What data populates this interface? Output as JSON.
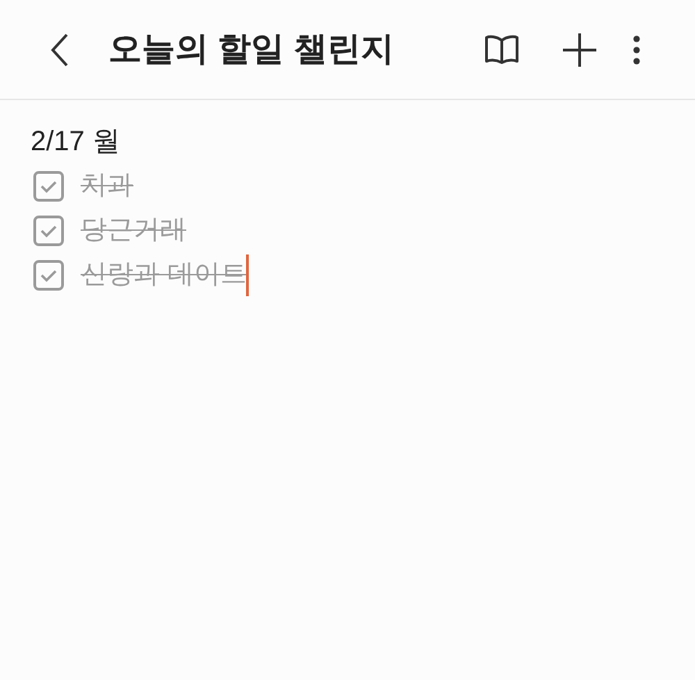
{
  "header": {
    "title": "오늘의 할일 챌린지"
  },
  "date": "2/17 월",
  "items": [
    {
      "text": "치과",
      "checked": true,
      "editing": false
    },
    {
      "text": "당근거래",
      "checked": true,
      "editing": false
    },
    {
      "text": "신랑과 데이트",
      "checked": true,
      "editing": true
    }
  ]
}
